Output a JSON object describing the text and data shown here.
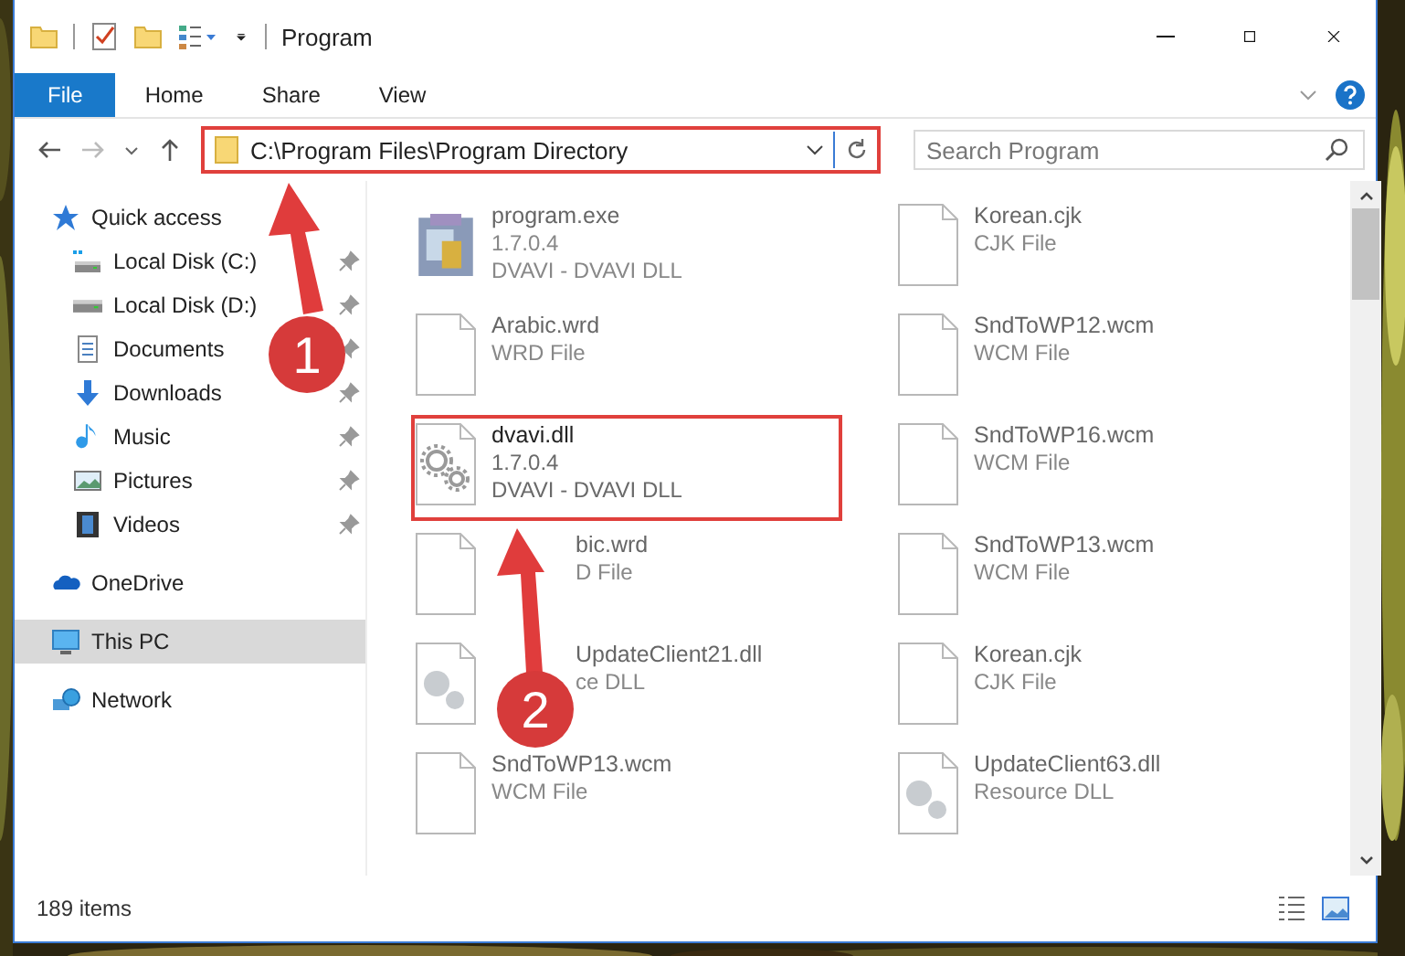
{
  "window": {
    "title": "Program"
  },
  "ribbon_tabs": [
    {
      "label": "File",
      "kind": "file",
      "selected": false
    },
    {
      "label": "Home",
      "kind": "tab",
      "selected": false
    },
    {
      "label": "Share",
      "kind": "tab",
      "selected": false
    },
    {
      "label": "View",
      "kind": "tab",
      "selected": false
    }
  ],
  "address_bar": {
    "path": "C:\\Program Files\\Program Directory",
    "highlighted": true
  },
  "search": {
    "placeholder": "Search Program"
  },
  "sidebar": {
    "items": [
      {
        "label": "Quick access",
        "kind": "quick-access",
        "selected": false,
        "children": [
          {
            "label": "Local Disk (C:)",
            "kind": "system-drive",
            "pinned": true,
            "selected": false
          },
          {
            "label": "Local Disk (D:)",
            "kind": "drive",
            "pinned": true,
            "selected": false
          },
          {
            "label": "Documents",
            "kind": "documents",
            "pinned": true,
            "selected": false
          },
          {
            "label": "Downloads",
            "kind": "downloads",
            "pinned": true,
            "selected": false
          },
          {
            "label": "Music",
            "kind": "music",
            "pinned": true,
            "selected": false
          },
          {
            "label": "Pictures",
            "kind": "pictures",
            "pinned": true,
            "selected": false
          },
          {
            "label": "Videos",
            "kind": "videos",
            "pinned": true,
            "selected": false
          }
        ]
      },
      {
        "label": "OneDrive",
        "kind": "cloud",
        "selected": false
      },
      {
        "label": "This PC",
        "kind": "computer",
        "selected": true
      },
      {
        "label": "Network",
        "kind": "network",
        "selected": false
      }
    ]
  },
  "files": [
    {
      "name": "program.exe",
      "details": [
        "1.7.0.4",
        "DVAVI - DVAVI DLL"
      ],
      "kind": "program",
      "blurred": true,
      "highlighted": false,
      "covered": false
    },
    {
      "name": "Arabic.wrd",
      "details": [
        "WRD File"
      ],
      "kind": "document",
      "blurred": true,
      "highlighted": false,
      "covered": false
    },
    {
      "name": "dvavi.dll",
      "details": [
        "1.7.0.4",
        "DVAVI - DVAVI DLL"
      ],
      "kind": "library",
      "blurred": false,
      "highlighted": true,
      "covered": false
    },
    {
      "name": "bic.wrd",
      "details": [
        "D File"
      ],
      "kind": "document",
      "blurred": true,
      "highlighted": false,
      "covered": true
    },
    {
      "name": "UpdateClient21.dll",
      "details": [
        "ce DLL"
      ],
      "kind": "library",
      "blurred": true,
      "highlighted": false,
      "covered": true
    },
    {
      "name": "SndToWP13.wcm",
      "details": [
        "WCM File"
      ],
      "kind": "document",
      "blurred": true,
      "highlighted": false,
      "covered": false
    },
    {
      "name": "Korean.cjk",
      "details": [
        "CJK File"
      ],
      "kind": "document",
      "blurred": true,
      "highlighted": false,
      "covered": false
    },
    {
      "name": "SndToWP12.wcm",
      "details": [
        "WCM File"
      ],
      "kind": "document",
      "blurred": true,
      "highlighted": false,
      "covered": false
    },
    {
      "name": "SndToWP16.wcm",
      "details": [
        "WCM File"
      ],
      "kind": "document",
      "blurred": true,
      "highlighted": false,
      "covered": false
    },
    {
      "name": "SndToWP13.wcm",
      "details": [
        "WCM File"
      ],
      "kind": "document",
      "blurred": true,
      "highlighted": false,
      "covered": false
    },
    {
      "name": "Korean.cjk",
      "details": [
        "CJK File"
      ],
      "kind": "document",
      "blurred": true,
      "highlighted": false,
      "covered": false
    },
    {
      "name": "UpdateClient63.dll",
      "details": [
        "Resource DLL"
      ],
      "kind": "library",
      "blurred": true,
      "highlighted": false,
      "covered": false
    }
  ],
  "status_bar": {
    "item_count": "189 items"
  },
  "annotations": [
    {
      "label": "1"
    },
    {
      "label": "2"
    }
  ]
}
